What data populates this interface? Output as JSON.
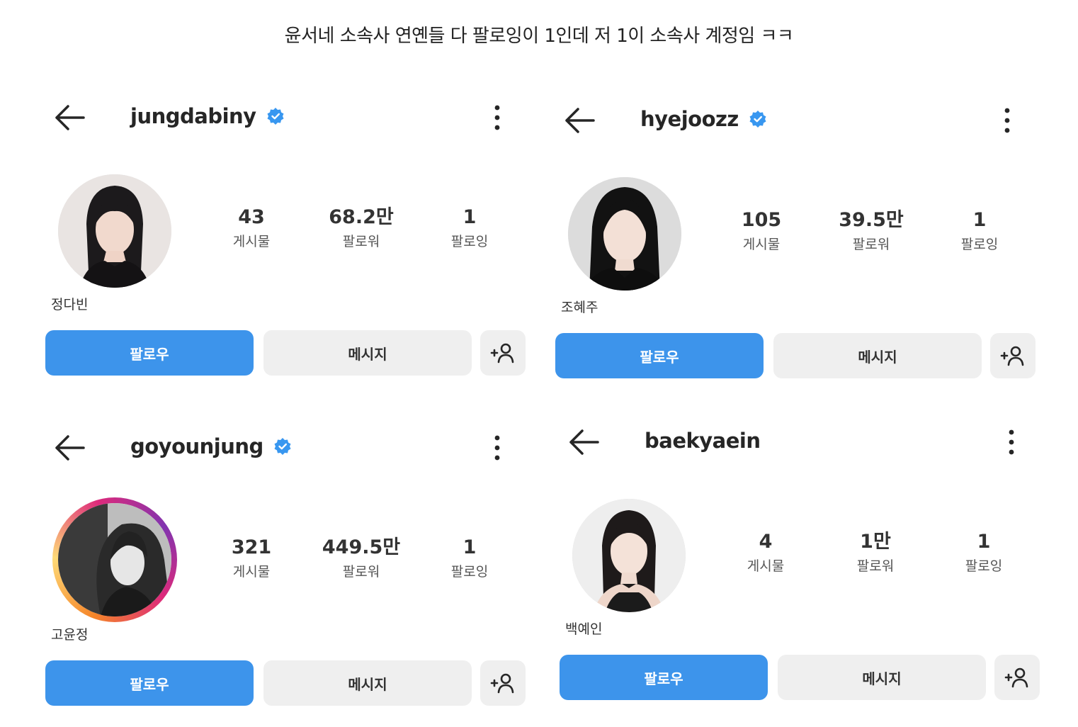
{
  "caption": "윤서네 소속사 연옌들 다 팔로잉이 1인데 저 1이 소속사 계정임 ㅋㅋ",
  "labels": {
    "posts": "게시물",
    "followers": "팔로워",
    "following": "팔로잉",
    "follow_button": "팔로우",
    "message_button": "메시지"
  },
  "colors": {
    "follow_button": "#3d94eb",
    "secondary_button": "#efefef",
    "verified_badge": "#3897f0"
  },
  "profiles": [
    {
      "username": "jungdabiny",
      "verified": true,
      "posts": "43",
      "followers": "68.2만",
      "following": "1",
      "name": "정다빈",
      "story_ring": false
    },
    {
      "username": "hyejoozz",
      "verified": true,
      "posts": "105",
      "followers": "39.5만",
      "following": "1",
      "name": "조혜주",
      "story_ring": false
    },
    {
      "username": "goyounjung",
      "verified": true,
      "posts": "321",
      "followers": "449.5만",
      "following": "1",
      "name": "고윤정",
      "story_ring": true
    },
    {
      "username": "baekyaein",
      "verified": false,
      "posts": "4",
      "followers": "1만",
      "following": "1",
      "name": "백예인",
      "story_ring": false
    }
  ],
  "icons": {
    "back": "arrow-left-icon",
    "verified": "verified-badge-icon",
    "more": "more-vertical-icon",
    "add_person": "add-person-icon"
  }
}
